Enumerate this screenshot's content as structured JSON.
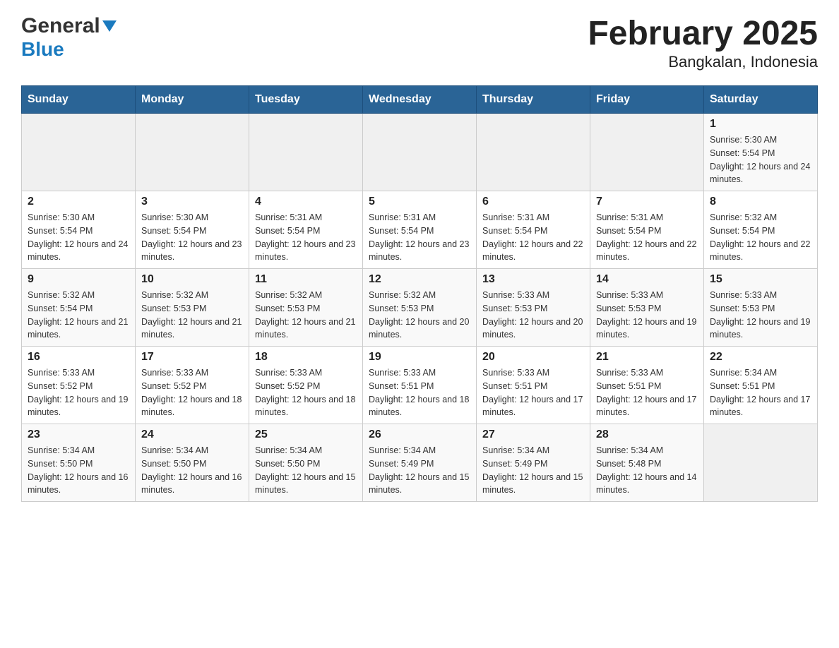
{
  "header": {
    "logo_general": "General",
    "logo_blue": "Blue",
    "title": "February 2025",
    "subtitle": "Bangkalan, Indonesia"
  },
  "calendar": {
    "days_of_week": [
      "Sunday",
      "Monday",
      "Tuesday",
      "Wednesday",
      "Thursday",
      "Friday",
      "Saturday"
    ],
    "weeks": [
      [
        {
          "num": "",
          "info": ""
        },
        {
          "num": "",
          "info": ""
        },
        {
          "num": "",
          "info": ""
        },
        {
          "num": "",
          "info": ""
        },
        {
          "num": "",
          "info": ""
        },
        {
          "num": "",
          "info": ""
        },
        {
          "num": "1",
          "info": "Sunrise: 5:30 AM\nSunset: 5:54 PM\nDaylight: 12 hours and 24 minutes."
        }
      ],
      [
        {
          "num": "2",
          "info": "Sunrise: 5:30 AM\nSunset: 5:54 PM\nDaylight: 12 hours and 24 minutes."
        },
        {
          "num": "3",
          "info": "Sunrise: 5:30 AM\nSunset: 5:54 PM\nDaylight: 12 hours and 23 minutes."
        },
        {
          "num": "4",
          "info": "Sunrise: 5:31 AM\nSunset: 5:54 PM\nDaylight: 12 hours and 23 minutes."
        },
        {
          "num": "5",
          "info": "Sunrise: 5:31 AM\nSunset: 5:54 PM\nDaylight: 12 hours and 23 minutes."
        },
        {
          "num": "6",
          "info": "Sunrise: 5:31 AM\nSunset: 5:54 PM\nDaylight: 12 hours and 22 minutes."
        },
        {
          "num": "7",
          "info": "Sunrise: 5:31 AM\nSunset: 5:54 PM\nDaylight: 12 hours and 22 minutes."
        },
        {
          "num": "8",
          "info": "Sunrise: 5:32 AM\nSunset: 5:54 PM\nDaylight: 12 hours and 22 minutes."
        }
      ],
      [
        {
          "num": "9",
          "info": "Sunrise: 5:32 AM\nSunset: 5:54 PM\nDaylight: 12 hours and 21 minutes."
        },
        {
          "num": "10",
          "info": "Sunrise: 5:32 AM\nSunset: 5:53 PM\nDaylight: 12 hours and 21 minutes."
        },
        {
          "num": "11",
          "info": "Sunrise: 5:32 AM\nSunset: 5:53 PM\nDaylight: 12 hours and 21 minutes."
        },
        {
          "num": "12",
          "info": "Sunrise: 5:32 AM\nSunset: 5:53 PM\nDaylight: 12 hours and 20 minutes."
        },
        {
          "num": "13",
          "info": "Sunrise: 5:33 AM\nSunset: 5:53 PM\nDaylight: 12 hours and 20 minutes."
        },
        {
          "num": "14",
          "info": "Sunrise: 5:33 AM\nSunset: 5:53 PM\nDaylight: 12 hours and 19 minutes."
        },
        {
          "num": "15",
          "info": "Sunrise: 5:33 AM\nSunset: 5:53 PM\nDaylight: 12 hours and 19 minutes."
        }
      ],
      [
        {
          "num": "16",
          "info": "Sunrise: 5:33 AM\nSunset: 5:52 PM\nDaylight: 12 hours and 19 minutes."
        },
        {
          "num": "17",
          "info": "Sunrise: 5:33 AM\nSunset: 5:52 PM\nDaylight: 12 hours and 18 minutes."
        },
        {
          "num": "18",
          "info": "Sunrise: 5:33 AM\nSunset: 5:52 PM\nDaylight: 12 hours and 18 minutes."
        },
        {
          "num": "19",
          "info": "Sunrise: 5:33 AM\nSunset: 5:51 PM\nDaylight: 12 hours and 18 minutes."
        },
        {
          "num": "20",
          "info": "Sunrise: 5:33 AM\nSunset: 5:51 PM\nDaylight: 12 hours and 17 minutes."
        },
        {
          "num": "21",
          "info": "Sunrise: 5:33 AM\nSunset: 5:51 PM\nDaylight: 12 hours and 17 minutes."
        },
        {
          "num": "22",
          "info": "Sunrise: 5:34 AM\nSunset: 5:51 PM\nDaylight: 12 hours and 17 minutes."
        }
      ],
      [
        {
          "num": "23",
          "info": "Sunrise: 5:34 AM\nSunset: 5:50 PM\nDaylight: 12 hours and 16 minutes."
        },
        {
          "num": "24",
          "info": "Sunrise: 5:34 AM\nSunset: 5:50 PM\nDaylight: 12 hours and 16 minutes."
        },
        {
          "num": "25",
          "info": "Sunrise: 5:34 AM\nSunset: 5:50 PM\nDaylight: 12 hours and 15 minutes."
        },
        {
          "num": "26",
          "info": "Sunrise: 5:34 AM\nSunset: 5:49 PM\nDaylight: 12 hours and 15 minutes."
        },
        {
          "num": "27",
          "info": "Sunrise: 5:34 AM\nSunset: 5:49 PM\nDaylight: 12 hours and 15 minutes."
        },
        {
          "num": "28",
          "info": "Sunrise: 5:34 AM\nSunset: 5:48 PM\nDaylight: 12 hours and 14 minutes."
        },
        {
          "num": "",
          "info": ""
        }
      ]
    ]
  }
}
